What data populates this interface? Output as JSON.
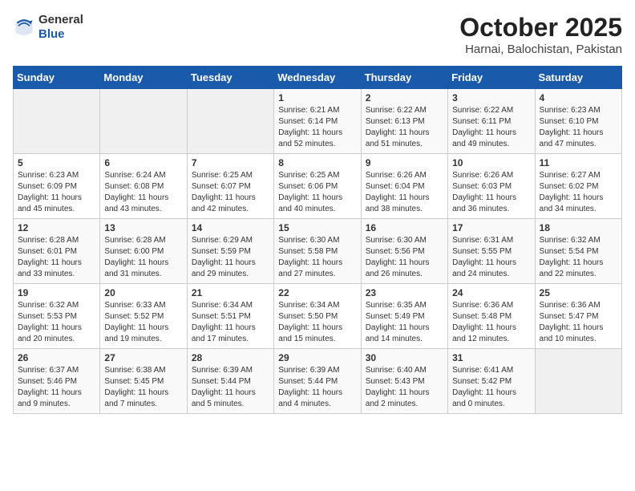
{
  "header": {
    "logo_general": "General",
    "logo_blue": "Blue",
    "title": "October 2025",
    "subtitle": "Harnai, Balochistan, Pakistan"
  },
  "weekdays": [
    "Sunday",
    "Monday",
    "Tuesday",
    "Wednesday",
    "Thursday",
    "Friday",
    "Saturday"
  ],
  "weeks": [
    [
      {
        "day": "",
        "info": ""
      },
      {
        "day": "",
        "info": ""
      },
      {
        "day": "",
        "info": ""
      },
      {
        "day": "1",
        "info": "Sunrise: 6:21 AM\nSunset: 6:14 PM\nDaylight: 11 hours\nand 52 minutes."
      },
      {
        "day": "2",
        "info": "Sunrise: 6:22 AM\nSunset: 6:13 PM\nDaylight: 11 hours\nand 51 minutes."
      },
      {
        "day": "3",
        "info": "Sunrise: 6:22 AM\nSunset: 6:11 PM\nDaylight: 11 hours\nand 49 minutes."
      },
      {
        "day": "4",
        "info": "Sunrise: 6:23 AM\nSunset: 6:10 PM\nDaylight: 11 hours\nand 47 minutes."
      }
    ],
    [
      {
        "day": "5",
        "info": "Sunrise: 6:23 AM\nSunset: 6:09 PM\nDaylight: 11 hours\nand 45 minutes."
      },
      {
        "day": "6",
        "info": "Sunrise: 6:24 AM\nSunset: 6:08 PM\nDaylight: 11 hours\nand 43 minutes."
      },
      {
        "day": "7",
        "info": "Sunrise: 6:25 AM\nSunset: 6:07 PM\nDaylight: 11 hours\nand 42 minutes."
      },
      {
        "day": "8",
        "info": "Sunrise: 6:25 AM\nSunset: 6:06 PM\nDaylight: 11 hours\nand 40 minutes."
      },
      {
        "day": "9",
        "info": "Sunrise: 6:26 AM\nSunset: 6:04 PM\nDaylight: 11 hours\nand 38 minutes."
      },
      {
        "day": "10",
        "info": "Sunrise: 6:26 AM\nSunset: 6:03 PM\nDaylight: 11 hours\nand 36 minutes."
      },
      {
        "day": "11",
        "info": "Sunrise: 6:27 AM\nSunset: 6:02 PM\nDaylight: 11 hours\nand 34 minutes."
      }
    ],
    [
      {
        "day": "12",
        "info": "Sunrise: 6:28 AM\nSunset: 6:01 PM\nDaylight: 11 hours\nand 33 minutes."
      },
      {
        "day": "13",
        "info": "Sunrise: 6:28 AM\nSunset: 6:00 PM\nDaylight: 11 hours\nand 31 minutes."
      },
      {
        "day": "14",
        "info": "Sunrise: 6:29 AM\nSunset: 5:59 PM\nDaylight: 11 hours\nand 29 minutes."
      },
      {
        "day": "15",
        "info": "Sunrise: 6:30 AM\nSunset: 5:58 PM\nDaylight: 11 hours\nand 27 minutes."
      },
      {
        "day": "16",
        "info": "Sunrise: 6:30 AM\nSunset: 5:56 PM\nDaylight: 11 hours\nand 26 minutes."
      },
      {
        "day": "17",
        "info": "Sunrise: 6:31 AM\nSunset: 5:55 PM\nDaylight: 11 hours\nand 24 minutes."
      },
      {
        "day": "18",
        "info": "Sunrise: 6:32 AM\nSunset: 5:54 PM\nDaylight: 11 hours\nand 22 minutes."
      }
    ],
    [
      {
        "day": "19",
        "info": "Sunrise: 6:32 AM\nSunset: 5:53 PM\nDaylight: 11 hours\nand 20 minutes."
      },
      {
        "day": "20",
        "info": "Sunrise: 6:33 AM\nSunset: 5:52 PM\nDaylight: 11 hours\nand 19 minutes."
      },
      {
        "day": "21",
        "info": "Sunrise: 6:34 AM\nSunset: 5:51 PM\nDaylight: 11 hours\nand 17 minutes."
      },
      {
        "day": "22",
        "info": "Sunrise: 6:34 AM\nSunset: 5:50 PM\nDaylight: 11 hours\nand 15 minutes."
      },
      {
        "day": "23",
        "info": "Sunrise: 6:35 AM\nSunset: 5:49 PM\nDaylight: 11 hours\nand 14 minutes."
      },
      {
        "day": "24",
        "info": "Sunrise: 6:36 AM\nSunset: 5:48 PM\nDaylight: 11 hours\nand 12 minutes."
      },
      {
        "day": "25",
        "info": "Sunrise: 6:36 AM\nSunset: 5:47 PM\nDaylight: 11 hours\nand 10 minutes."
      }
    ],
    [
      {
        "day": "26",
        "info": "Sunrise: 6:37 AM\nSunset: 5:46 PM\nDaylight: 11 hours\nand 9 minutes."
      },
      {
        "day": "27",
        "info": "Sunrise: 6:38 AM\nSunset: 5:45 PM\nDaylight: 11 hours\nand 7 minutes."
      },
      {
        "day": "28",
        "info": "Sunrise: 6:39 AM\nSunset: 5:44 PM\nDaylight: 11 hours\nand 5 minutes."
      },
      {
        "day": "29",
        "info": "Sunrise: 6:39 AM\nSunset: 5:44 PM\nDaylight: 11 hours\nand 4 minutes."
      },
      {
        "day": "30",
        "info": "Sunrise: 6:40 AM\nSunset: 5:43 PM\nDaylight: 11 hours\nand 2 minutes."
      },
      {
        "day": "31",
        "info": "Sunrise: 6:41 AM\nSunset: 5:42 PM\nDaylight: 11 hours\nand 0 minutes."
      },
      {
        "day": "",
        "info": ""
      }
    ]
  ]
}
